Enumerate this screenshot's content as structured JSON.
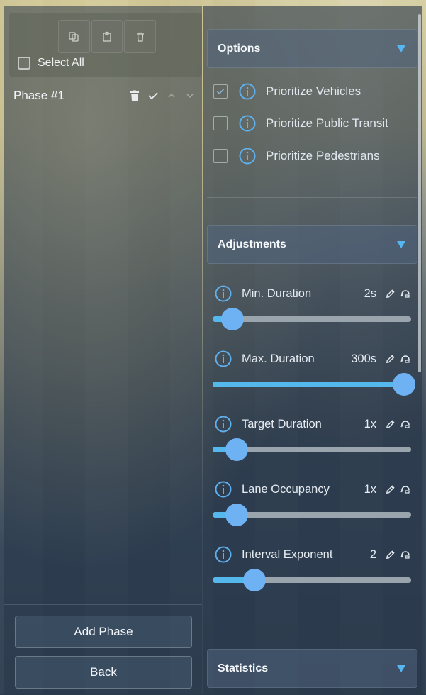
{
  "left": {
    "select_all_label": "Select All",
    "phase_title": "Phase #1",
    "add_phase_label": "Add Phase",
    "back_label": "Back"
  },
  "options": {
    "title": "Options",
    "items": [
      {
        "label": "Prioritize Vehicles",
        "checked": true
      },
      {
        "label": "Prioritize Public Transit",
        "checked": false
      },
      {
        "label": "Prioritize Pedestrians",
        "checked": false
      }
    ]
  },
  "adjustments": {
    "title": "Adjustments",
    "items": [
      {
        "label": "Min. Duration",
        "value": "2s",
        "level": 0.1
      },
      {
        "label": "Max. Duration",
        "value": "300s",
        "level": 1.0
      },
      {
        "label": "Target Duration",
        "value": "1x",
        "level": 0.12
      },
      {
        "label": "Lane Occupancy",
        "value": "1x",
        "level": 0.12
      },
      {
        "label": "Interval Exponent",
        "value": "2",
        "level": 0.21
      }
    ]
  },
  "statistics": {
    "title": "Statistics"
  },
  "colors": {
    "accent": "#55b8ec",
    "thumb": "#6fb2f4",
    "track": "#9aa4ad"
  },
  "icons": {
    "copy": "copy-icon",
    "paste": "paste-icon",
    "delete": "trash-icon",
    "confirm": "check-icon",
    "up": "chevron-up-icon",
    "down": "chevron-down-icon",
    "info": "info-icon",
    "edit": "pencil-icon",
    "reset": "reset-icon",
    "expand": "triangle-down-icon"
  }
}
